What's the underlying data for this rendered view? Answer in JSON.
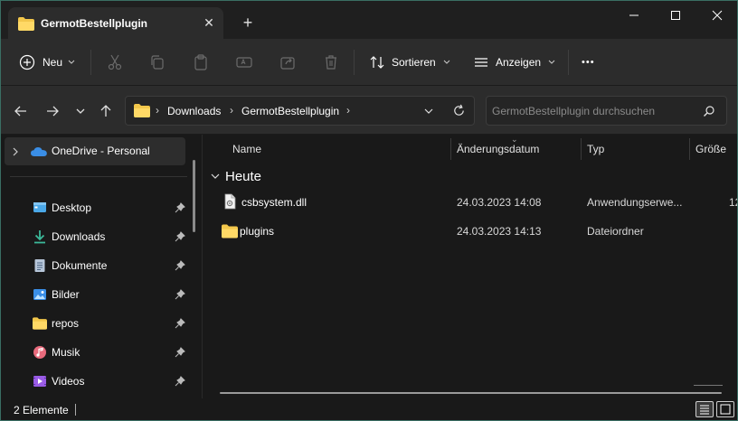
{
  "window": {
    "tab_title": "GermotBestellplugin",
    "tab_close": "✕",
    "new_tab": "+"
  },
  "commands": {
    "new_label": "Neu",
    "sort_label": "Sortieren",
    "view_label": "Anzeigen",
    "more": "•••"
  },
  "address": {
    "crumbs": [
      "Downloads",
      "GermotBestellplugin"
    ],
    "search_placeholder": "GermotBestellplugin durchsuchen"
  },
  "sidebar": {
    "onedrive": "OneDrive - Personal",
    "items": [
      {
        "label": "Desktop",
        "icon": "desktop-icon"
      },
      {
        "label": "Downloads",
        "icon": "downloads-icon"
      },
      {
        "label": "Dokumente",
        "icon": "documents-icon"
      },
      {
        "label": "Bilder",
        "icon": "pictures-icon"
      },
      {
        "label": "repos",
        "icon": "folder-icon"
      },
      {
        "label": "Musik",
        "icon": "music-icon"
      },
      {
        "label": "Videos",
        "icon": "videos-icon"
      }
    ]
  },
  "columns": {
    "name": "Name",
    "date": "Änderungsdatum",
    "type": "Typ",
    "size": "Größe"
  },
  "group": {
    "label": "Heute"
  },
  "files": [
    {
      "name": "csbsystem.dll",
      "date": "24.03.2023 14:08",
      "type": "Anwendungserwe...",
      "size": "12",
      "icon": "dll-file-icon"
    },
    {
      "name": "plugins",
      "date": "24.03.2023 14:13",
      "type": "Dateiordner",
      "size": "",
      "icon": "folder-icon"
    }
  ],
  "status": {
    "count": "2 Elemente"
  },
  "colors": {
    "accent_border": "#3a6e63",
    "folder_yellow": "#f3c74b",
    "onedrive_blue": "#3a8ee6"
  }
}
